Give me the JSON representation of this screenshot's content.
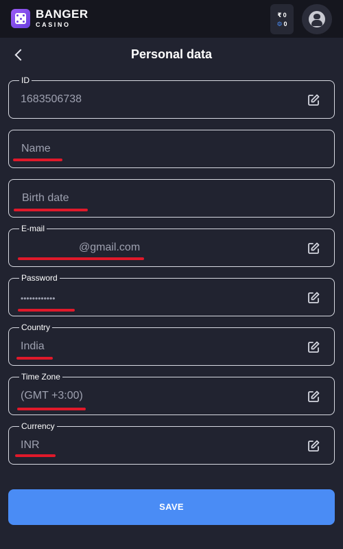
{
  "brand": {
    "title": "BANGER",
    "subtitle": "CASINO"
  },
  "balance": {
    "currency_symbol": "₹",
    "currency_value": "0",
    "bonus_value": "0"
  },
  "page": {
    "title": "Personal data"
  },
  "fields": {
    "id": {
      "label": "ID",
      "value": "1683506738"
    },
    "name": {
      "placeholder": "Name"
    },
    "birth_date": {
      "placeholder": "Birth date"
    },
    "email": {
      "label": "E-mail",
      "value": "@gmail.com"
    },
    "password": {
      "label": "Password",
      "value": "••••••••••••"
    },
    "country": {
      "label": "Country",
      "value": "India"
    },
    "time_zone": {
      "label": "Time Zone",
      "value": "(GMT +3:00)"
    },
    "currency": {
      "label": "Currency",
      "value": "INR"
    }
  },
  "actions": {
    "save_label": "SAVE"
  },
  "colors": {
    "background": "#212330",
    "header": "#15161e",
    "accent": "#4a8cf5",
    "brand": "#7b4bea",
    "annotation": "#e0192a"
  }
}
